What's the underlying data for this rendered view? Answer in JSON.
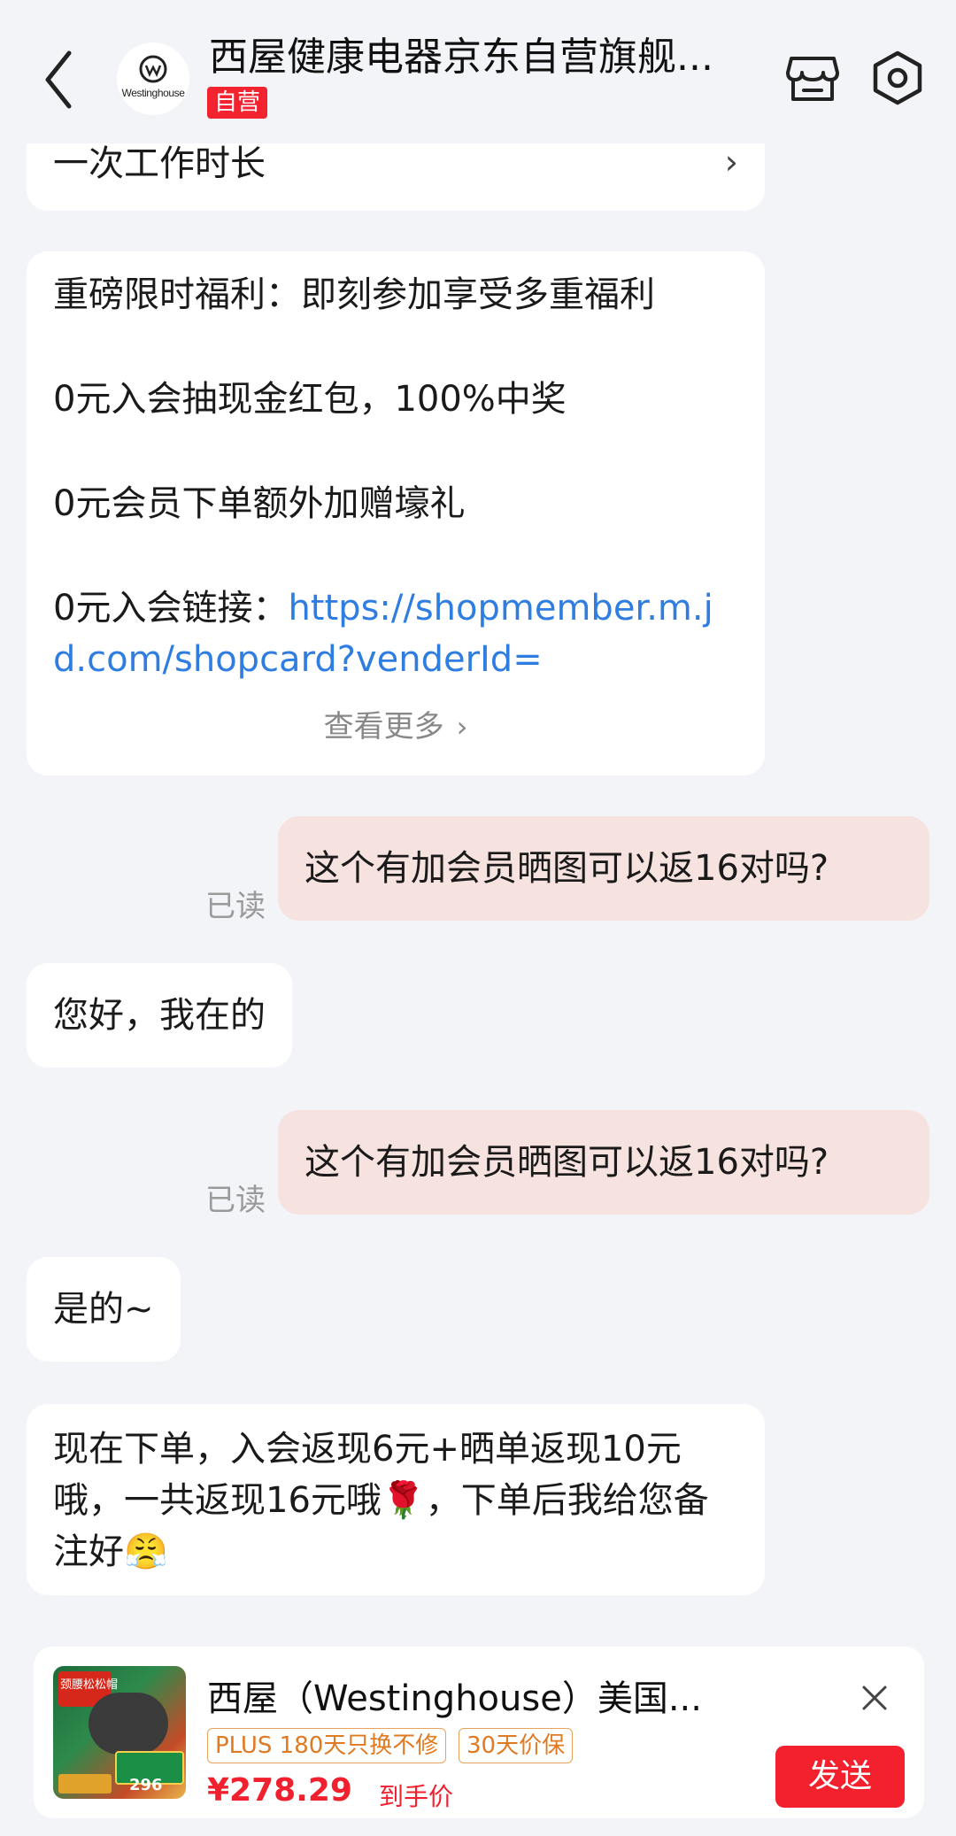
{
  "header": {
    "store_name": "西屋健康电器京东自营旗舰...",
    "self_operated_badge": "自营",
    "logo_text": "Westinghouse"
  },
  "messages": {
    "partial_card": {
      "text": "一次工作时长",
      "chevron": "›"
    },
    "promo_card": {
      "line1": "重磅限时福利：即刻参加享受多重福利",
      "line2": "0元入会抽现金红包，100%中奖",
      "line3": "0元会员下单额外加赠壕礼",
      "line4_label": "0元入会链接：",
      "line4_link": "https://shopmember.m.jd.com/shopcard?venderId=",
      "view_more": "查看更多"
    },
    "sent1": {
      "text": "这个有加会员晒图可以返16对吗?",
      "status": "已读"
    },
    "reply1": "您好，我在的",
    "sent2": {
      "text": "这个有加会员晒图可以返16对吗?",
      "status": "已读"
    },
    "reply2": "是的~",
    "reply3": "现在下单，入会返现6元+晒单返现10元哦，一共返现16元哦🌹，下单后我给您备注好😤"
  },
  "product": {
    "name": "西屋（Westinghouse）美国...",
    "tag1": "PLUS 180天只换不修",
    "tag2": "30天价保",
    "price": "¥278.29",
    "price_note": "到手价",
    "send_label": "发送",
    "image_label_1": "颈腰松松帽",
    "image_label_2": "296"
  },
  "colors": {
    "accent_red": "#f3202e",
    "sent_bubble": "#f6e2de",
    "link_blue": "#2f7de1",
    "background": "#f3f4f8"
  },
  "icons": [
    "back-icon",
    "store-icon",
    "settings-icon",
    "chevron-right-icon",
    "close-icon"
  ]
}
